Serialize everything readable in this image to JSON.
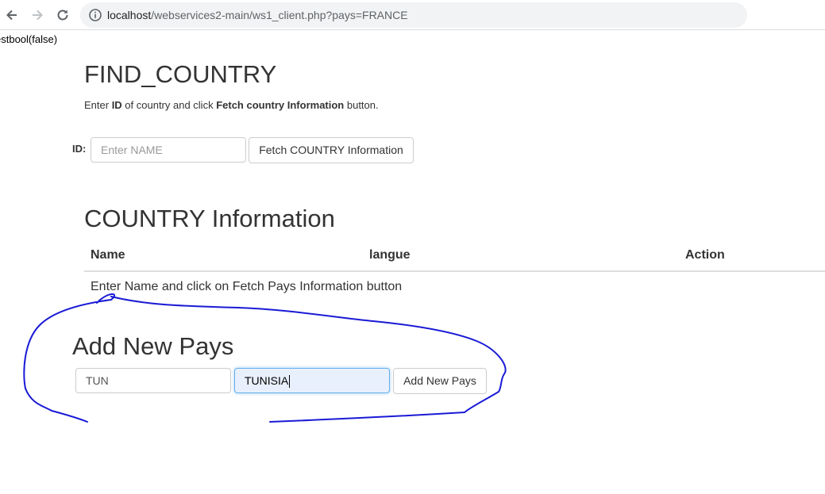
{
  "browser": {
    "url_host": "localhost",
    "url_path": "/webservices2-main/ws1_client.php?pays=FRANCE"
  },
  "debug_output": "estbool(false)",
  "find": {
    "title": "FIND_COUNTRY",
    "instr_pre": "Enter ",
    "instr_bold1": "ID",
    "instr_mid": " of country and click ",
    "instr_bold2": "Fetch country Information",
    "instr_post": " button.",
    "id_label": "ID:",
    "input_placeholder": "Enter NAME",
    "input_value": "",
    "fetch_button": "Fetch COUNTRY Information"
  },
  "info": {
    "title": "COUNTRY Information",
    "columns": [
      "Name",
      "langue",
      "Action"
    ],
    "empty_message": "Enter Name and click on Fetch Pays Information button"
  },
  "add": {
    "title": "Add New Pays",
    "code_value": "TUN",
    "name_value": "TUNISIA",
    "button": "Add New Pays"
  },
  "annotation_color": "#1a1ad6",
  "icons": [
    "back-arrow-icon",
    "forward-arrow-icon",
    "reload-icon",
    "info-icon"
  ]
}
